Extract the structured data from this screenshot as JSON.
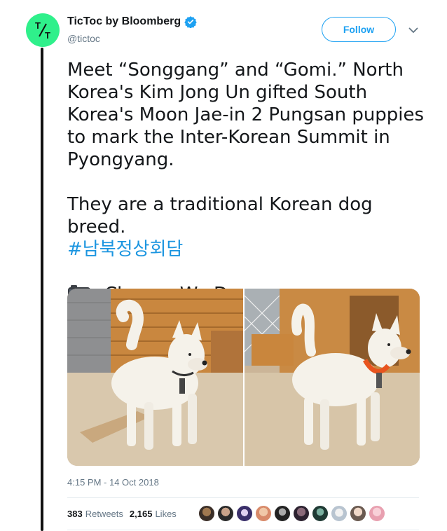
{
  "author": {
    "display_name": "TicToc by Bloomberg",
    "handle": "@tictoc",
    "avatar_text": "T/T",
    "avatar_color": "#2ff08b",
    "verified": true
  },
  "follow_button": {
    "label": "Follow"
  },
  "menu": {
    "icon": "chevron-down-icon"
  },
  "tweet": {
    "paragraph1": "Meet “Songgang” and “Gomi.” North Korea's Kim Jong Un gifted South Korea's Moon Jae-in 2 Pungsan puppies to mark the Inter-Korean Summit in Pyongyang.",
    "paragraph2": "They are a traditional Korean dog breed.",
    "hashtag": "#남북정상회담",
    "credit_icon": "camera-icon",
    "credit": ": Cheong Wa Dae"
  },
  "media": {
    "photos": [
      {
        "subject": "white dog with black collar"
      },
      {
        "subject": "white dog with orange collar"
      }
    ]
  },
  "timestamp": "4:15 PM - 14 Oct 2018",
  "stats": {
    "retweets_count": "383",
    "retweets_label": "Retweets",
    "likes_count": "2,165",
    "likes_label": "Likes"
  },
  "likers": [
    "avatar-1",
    "avatar-2",
    "avatar-3",
    "avatar-4",
    "avatar-5",
    "avatar-6",
    "avatar-7",
    "avatar-8",
    "avatar-9",
    "avatar-10"
  ],
  "colors": {
    "accent": "#1da1f2",
    "hashtag": "#1b95e0",
    "muted": "#657786",
    "thread_line": "#111111"
  }
}
